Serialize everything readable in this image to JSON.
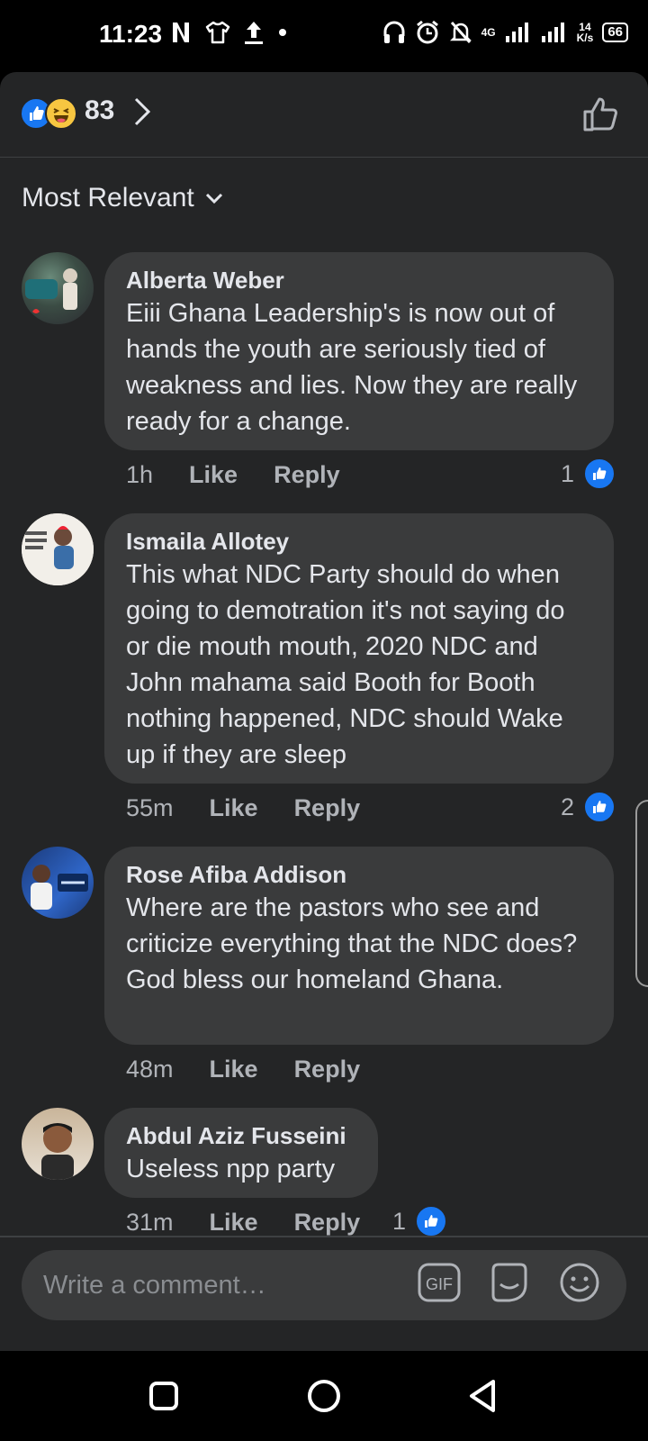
{
  "status_bar": {
    "time": "11:23",
    "network": "4G",
    "net_speed_value": "14",
    "net_speed_unit": "K/s",
    "battery": "66"
  },
  "header": {
    "reaction_count": "83",
    "reaction_types": [
      "like",
      "haha"
    ]
  },
  "sort": {
    "label": "Most Relevant"
  },
  "comments": [
    {
      "author": "Alberta Weber",
      "text": "Eiii Ghana  Leadership's is now out of hands the youth are seriously tied of weakness and lies.  Now they are really ready for a change.",
      "time": "1h",
      "like_label": "Like",
      "reply_label": "Reply",
      "reactions": "1"
    },
    {
      "author": "Ismaila Allotey",
      "text": "This what NDC Party should do when going to  demotration it's not saying do or die mouth mouth, 2020 NDC and John mahama said Booth for Booth nothing happened, NDC should Wake up if they are sleep",
      "time": "55m",
      "like_label": "Like",
      "reply_label": "Reply",
      "reactions": "2"
    },
    {
      "author": "Rose Afiba Addison",
      "text": "Where are the pastors who see and criticize everything that the NDC does? God bless our homeland Ghana.",
      "time": "48m",
      "like_label": "Like",
      "reply_label": "Reply",
      "reactions": ""
    },
    {
      "author": "Abdul Aziz Fusseini",
      "text": "Useless npp party",
      "time": "31m",
      "like_label": "Like",
      "reply_label": "Reply",
      "reactions": "1"
    }
  ],
  "composer": {
    "placeholder": "Write a comment…",
    "gif_label": "GIF"
  },
  "colors": {
    "background": "#242526",
    "bubble": "#3a3b3c",
    "like_blue": "#1877f2",
    "text": "#e4e6eb",
    "muted": "#b0b3b8"
  }
}
